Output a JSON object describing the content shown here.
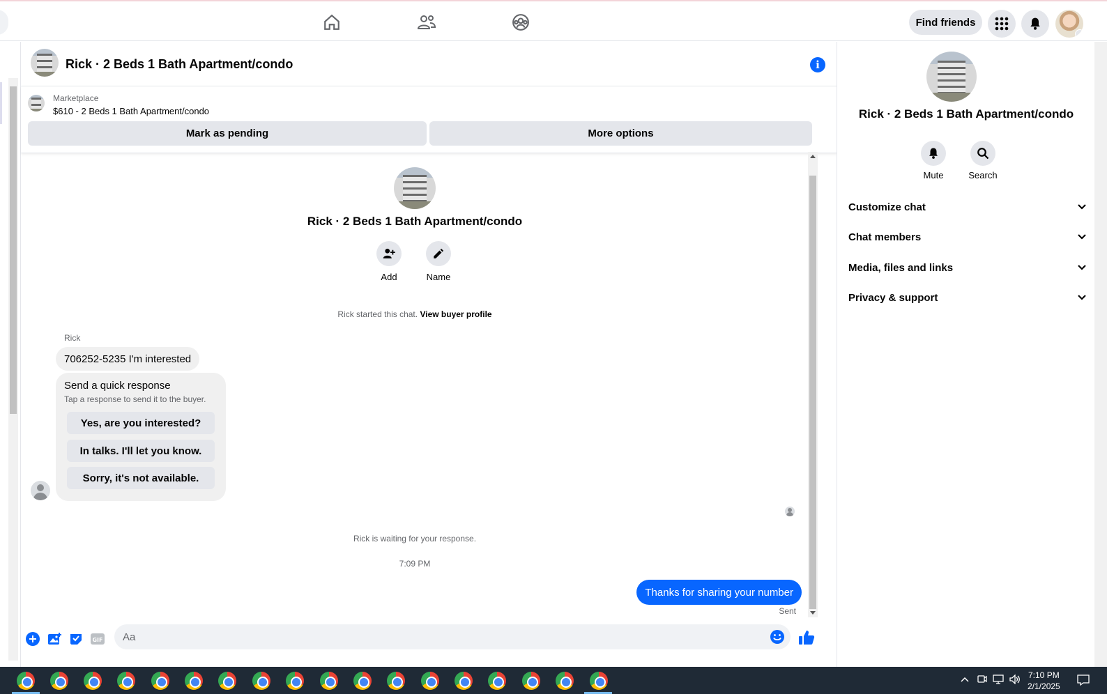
{
  "topbar": {
    "find_friends_label": "Find friends",
    "nav_icons": [
      "home-icon",
      "friends-icon",
      "groups-icon"
    ]
  },
  "chat": {
    "header_title": "Rick · 2 Beds 1 Bath Apartment/condo",
    "marketplace": {
      "label": "Marketplace",
      "listing": "$610 - 2 Beds 1 Bath Apartment/condo",
      "mark_pending_label": "Mark as pending",
      "more_options_label": "More options"
    },
    "intro": {
      "title": "Rick · 2 Beds 1 Bath Apartment/condo",
      "add_label": "Add",
      "name_label": "Name",
      "started_text": "Rick started this chat.",
      "view_profile_label": "View buyer profile"
    },
    "messages": {
      "sender_name": "Rick",
      "incoming_text": "706252-5235 I'm interested",
      "quick_response": {
        "title": "Send a quick response",
        "subtitle": "Tap a response to send it to the buyer.",
        "options": [
          "Yes, are you interested?",
          "In talks. I'll let you know.",
          "Sorry, it's not available."
        ]
      },
      "waiting_text": "Rick is waiting for your response.",
      "timestamp": "7:09 PM",
      "outgoing_text": "Thanks for sharing your number",
      "status": "Sent"
    },
    "composer": {
      "placeholder": "Aa"
    }
  },
  "details": {
    "title": "Rick · 2 Beds 1 Bath Apartment/condo",
    "mute_label": "Mute",
    "search_label": "Search",
    "sections": [
      "Customize chat",
      "Chat members",
      "Media, files and links",
      "Privacy & support"
    ]
  },
  "taskbar": {
    "time": "7:10 PM",
    "date": "2/1/2025"
  },
  "colors": {
    "accent": "#0866ff",
    "bubble_in": "#f0f0f0",
    "button_bg": "#e4e6eb"
  }
}
